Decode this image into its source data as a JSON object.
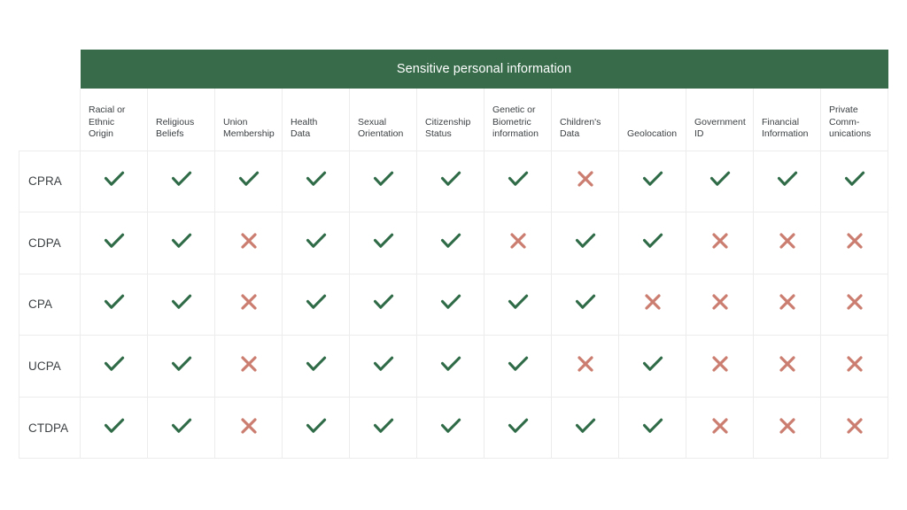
{
  "table": {
    "banner_label": "Sensitive personal information",
    "corner_label": "",
    "colors": {
      "banner_background": "#376b4a",
      "check_mark": "#2f6b47",
      "cross_mark": "#cb7d70",
      "grid_line": "#ececec",
      "text": "#3c4043",
      "banner_text": "#ffffff"
    },
    "columns": [
      {
        "label": "Racial or\nEthnic\nOrigin",
        "name": "racial-or-ethnic-origin"
      },
      {
        "label": "Religious\nBeliefs",
        "name": "religious-beliefs"
      },
      {
        "label": "Union\nMembership",
        "name": "union-membership"
      },
      {
        "label": "Health\nData",
        "name": "health-data"
      },
      {
        "label": "Sexual\nOrientation",
        "name": "sexual-orientation"
      },
      {
        "label": "Citizenship\nStatus",
        "name": "citizenship-status"
      },
      {
        "label": "Genetic or\nBiometric\ninformation",
        "name": "genetic-or-biometric-information"
      },
      {
        "label": "Children's\nData",
        "name": "childrens-data"
      },
      {
        "label": "Geolocation",
        "name": "geolocation"
      },
      {
        "label": "Government\nID",
        "name": "government-id"
      },
      {
        "label": "Financial\nInformation",
        "name": "financial-information"
      },
      {
        "label": "Private\nComm-\nunications",
        "name": "private-communications"
      }
    ],
    "rows": [
      {
        "label": "CPRA",
        "name": "cpra",
        "values": [
          "check",
          "check",
          "check",
          "check",
          "check",
          "check",
          "check",
          "cross",
          "check",
          "check",
          "check",
          "check"
        ]
      },
      {
        "label": "CDPA",
        "name": "cdpa",
        "values": [
          "check",
          "check",
          "cross",
          "check",
          "check",
          "check",
          "cross",
          "check",
          "check",
          "cross",
          "cross",
          "cross"
        ]
      },
      {
        "label": "CPA",
        "name": "cpa",
        "values": [
          "check",
          "check",
          "cross",
          "check",
          "check",
          "check",
          "check",
          "check",
          "cross",
          "cross",
          "cross",
          "cross"
        ]
      },
      {
        "label": "UCPA",
        "name": "ucpa",
        "values": [
          "check",
          "check",
          "cross",
          "check",
          "check",
          "check",
          "check",
          "cross",
          "check",
          "cross",
          "cross",
          "cross"
        ]
      },
      {
        "label": "CTDPA",
        "name": "ctdpa",
        "values": [
          "check",
          "check",
          "cross",
          "check",
          "check",
          "check",
          "check",
          "check",
          "check",
          "cross",
          "cross",
          "cross"
        ]
      }
    ],
    "mark_legend": {
      "check": "check-mark-icon",
      "cross": "cross-mark-icon"
    }
  }
}
